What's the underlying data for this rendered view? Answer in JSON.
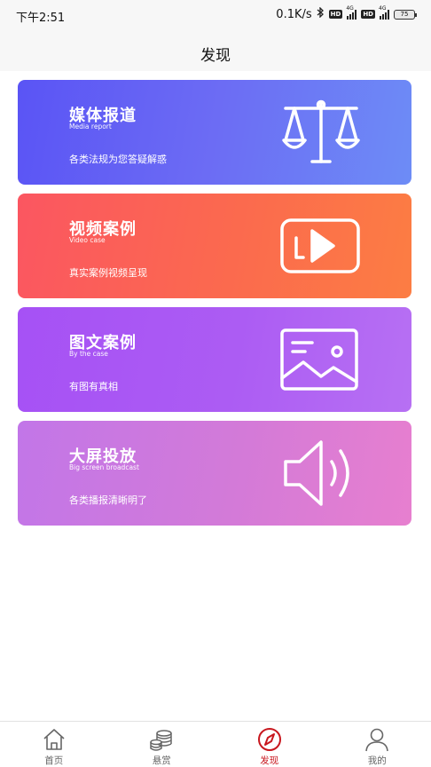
{
  "status_bar": {
    "time": "下午2:51",
    "speed": "0.1K/s",
    "hd": "HD",
    "network": "4G",
    "battery": "75"
  },
  "header": {
    "title": "发现"
  },
  "cards": [
    {
      "title": "媒体报道",
      "subtitle": "Media report",
      "desc": "各类法规为您答疑解惑",
      "icon": "scales-icon"
    },
    {
      "title": "视频案例",
      "subtitle": "Video case",
      "desc": "真实案例视频呈现",
      "icon": "video-play-icon"
    },
    {
      "title": "图文案例",
      "subtitle": "By the case",
      "desc": "有图有真相",
      "icon": "picture-icon"
    },
    {
      "title": "大屏投放",
      "subtitle": "Big screen broadcast",
      "desc": "各类播报清晰明了",
      "icon": "speaker-icon"
    }
  ],
  "tabs": [
    {
      "label": "首页",
      "icon": "home-icon"
    },
    {
      "label": "悬赏",
      "icon": "coins-icon"
    },
    {
      "label": "发现",
      "icon": "compass-icon",
      "active": true
    },
    {
      "label": "我的",
      "icon": "user-icon"
    }
  ],
  "colors": {
    "active_tab": "#c8171e",
    "inactive_tab": "#666666"
  }
}
